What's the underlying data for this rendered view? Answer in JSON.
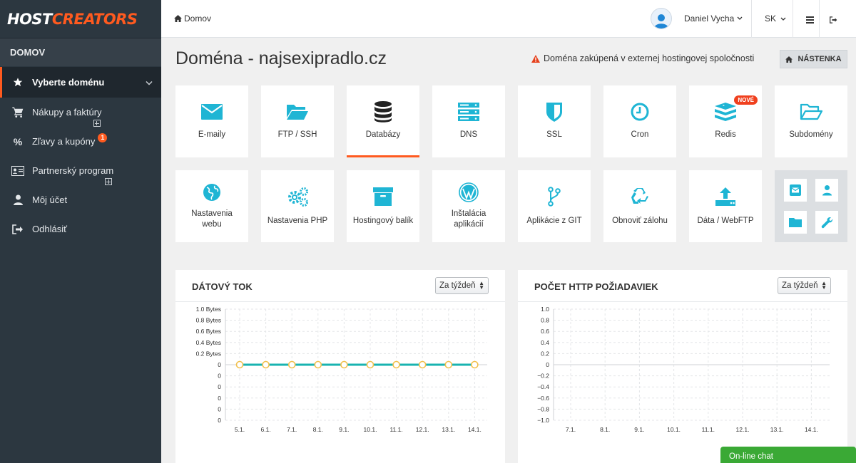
{
  "brand": {
    "part1": "HOST",
    "part2": "CREATORS"
  },
  "sidebar": {
    "section": "DOMOV",
    "items": [
      {
        "label": "Vyberte doménu",
        "icon": "star-icon"
      },
      {
        "label": "Nákupy a faktúry",
        "icon": "cart-icon"
      },
      {
        "label": "Zľavy a kupóny",
        "icon": "percent-icon",
        "badge": "1"
      },
      {
        "label": "Partnerský program",
        "icon": "id-card-icon"
      },
      {
        "label": "Môj účet",
        "icon": "user-icon"
      },
      {
        "label": "Odhlásiť",
        "icon": "sign-out-icon"
      }
    ]
  },
  "topbar": {
    "breadcrumb": "Domov",
    "user_name": "Daniel Vycha",
    "language": "SK"
  },
  "page": {
    "title": "Doména - najsexipradlo.cz",
    "warning": "Doména zakúpená v externej hostingovej spoločnosti",
    "dashboard_button": "NÁSTENKA"
  },
  "tiles_row1": [
    {
      "label": "E-maily",
      "icon": "envelope-icon"
    },
    {
      "label": "FTP / SSH",
      "icon": "folder-open-icon"
    },
    {
      "label": "Databázy",
      "icon": "database-icon",
      "active": true
    },
    {
      "label": "DNS",
      "icon": "server-icon"
    },
    {
      "label": "SSL",
      "icon": "shield-icon"
    },
    {
      "label": "Cron",
      "icon": "clock-icon"
    },
    {
      "label": "Redis",
      "icon": "redis-icon",
      "badge": "NOVÉ"
    },
    {
      "label": "Subdomény",
      "icon": "folder-outline-icon"
    }
  ],
  "tiles_row2": [
    {
      "line1": "Nastavenia",
      "line2": "webu",
      "icon": "globe-icon"
    },
    {
      "line1": "Nastavenia PHP",
      "line2": "",
      "icon": "cogs-icon"
    },
    {
      "line1": "Hostingový balík",
      "line2": "",
      "icon": "archive-icon"
    },
    {
      "line1": "Inštalácia",
      "line2": "aplikácií",
      "icon": "wordpress-icon"
    },
    {
      "line1": "Aplikácie z GIT",
      "line2": "",
      "icon": "git-branch-icon"
    },
    {
      "line1": "Obnoviť zálohu",
      "line2": "",
      "icon": "recycle-icon"
    },
    {
      "line1": "Dáta / WebFTP",
      "line2": "",
      "icon": "upload-icon"
    }
  ],
  "quick_icons": [
    "envelope-square-icon",
    "user-icon",
    "folder-icon",
    "wrench-icon"
  ],
  "colors": {
    "accent": "#ff5a1f",
    "icon": "#1fb5d4",
    "sidebar": "#2c3740",
    "line": "#19b3b0"
  },
  "panels": {
    "traffic": {
      "title": "DÁTOVÝ TOK",
      "period": "Za týždeň"
    },
    "requests": {
      "title": "POČET HTTP POŽIADAVIEK",
      "period": "Za týždeň"
    }
  },
  "chart_data": [
    {
      "type": "line",
      "title": "DÁTOVÝ TOK",
      "categories": [
        "5.1.",
        "6.1.",
        "7.1.",
        "8.1.",
        "9.1.",
        "10.1.",
        "11.1.",
        "12.1.",
        "13.1.",
        "14.1."
      ],
      "values": [
        0,
        0,
        0,
        0,
        0,
        0,
        0,
        0,
        0,
        0
      ],
      "y_ticks": [
        "1.0 Bytes",
        "0.8 Bytes",
        "0.6 Bytes",
        "0.4 Bytes",
        "0.2 Bytes",
        "0",
        "0",
        "0",
        "0",
        "0",
        "0"
      ],
      "grid": true
    },
    {
      "type": "line",
      "title": "POČET HTTP POŽIADAVIEK",
      "categories": [
        "7.1.",
        "8.1.",
        "9.1.",
        "10.1.",
        "11.1.",
        "12.1.",
        "13.1.",
        "14.1."
      ],
      "values": [],
      "y_ticks": [
        "1.0",
        "0.8",
        "0.6",
        "0.4",
        "0.2",
        "0",
        "−0.2",
        "−0.4",
        "−0.6",
        "−0.8",
        "−1.0"
      ],
      "ylim": [
        -1.0,
        1.0
      ],
      "grid": true
    }
  ],
  "chat": {
    "label": "On-line chat"
  }
}
